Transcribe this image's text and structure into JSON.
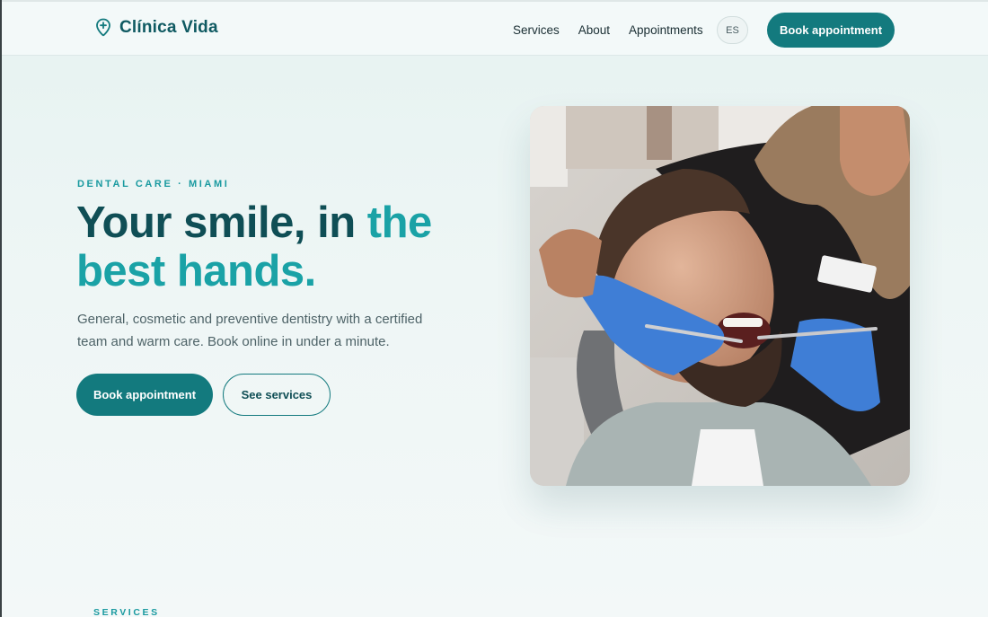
{
  "brand": {
    "name": "Clínica Vida",
    "icon": "location-pin-plus-icon"
  },
  "nav": {
    "items": [
      "Services",
      "About",
      "Appointments"
    ],
    "language": "ES",
    "cta": "Book appointment"
  },
  "hero": {
    "eyebrow": "DENTAL CARE · MIAMI",
    "headline_part1": "Your smile, in ",
    "headline_accent": "the best hands.",
    "lede": "General, cosmetic and preventive dentistry with a certified team and warm care. Book online in under a minute.",
    "primary_cta": "Book appointment",
    "secondary_cta": "See services",
    "image": "dentist-examining-patient-photo"
  },
  "sections": {
    "services_label": "SERVICES"
  },
  "colors": {
    "brand": "#137a7e",
    "accent": "#1aa2a6",
    "heading": "#0f4e55"
  }
}
